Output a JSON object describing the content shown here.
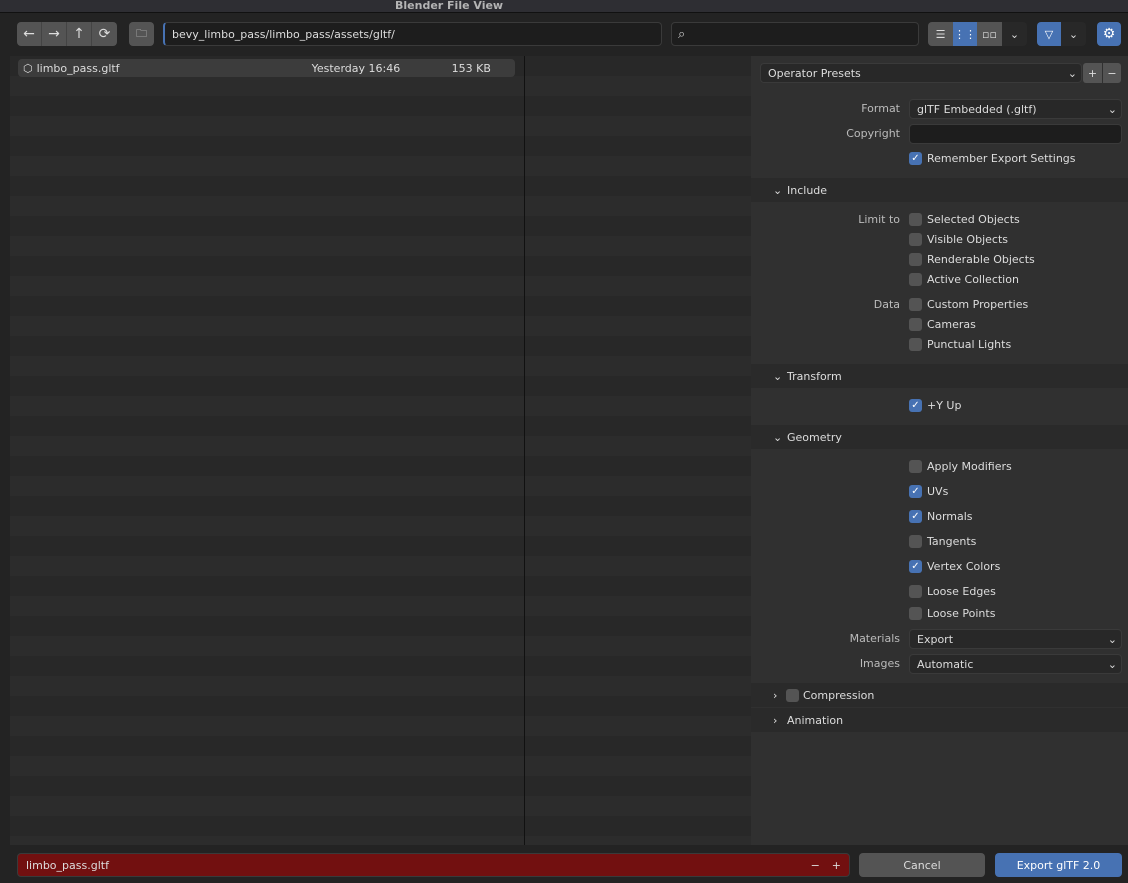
{
  "window": {
    "title": "Blender File View"
  },
  "toolbar": {
    "path": "bevy_limbo_pass/limbo_pass/assets/gltf/",
    "search_placeholder": "",
    "back": "←",
    "forward": "→",
    "parent": "↑",
    "refresh": "⟳",
    "view_modes": [
      "vertical-list",
      "horizontal-list",
      "thumbnails"
    ],
    "active_view": "horizontal-list",
    "accent": "#4772b3"
  },
  "files": [
    {
      "name": "limbo_pass.gltf",
      "date": "Yesterday 16:46",
      "size": "153 KB",
      "icon": "mesh-cube-icon"
    }
  ],
  "panel": {
    "presets": "Operator Presets",
    "format_label": "Format",
    "format_value": "glTF Embedded (.gltf)",
    "copyright_label": "Copyright",
    "copyright_value": "",
    "remember": {
      "label": "Remember Export Settings",
      "checked": true
    },
    "include": {
      "title": "Include",
      "limit_label": "Limit to",
      "limit": [
        {
          "label": "Selected Objects",
          "checked": false
        },
        {
          "label": "Visible Objects",
          "checked": false
        },
        {
          "label": "Renderable Objects",
          "checked": false
        },
        {
          "label": "Active Collection",
          "checked": false
        }
      ],
      "data_label": "Data",
      "data": [
        {
          "label": "Custom Properties",
          "checked": false
        },
        {
          "label": "Cameras",
          "checked": false
        },
        {
          "label": "Punctual Lights",
          "checked": false
        }
      ]
    },
    "transform": {
      "title": "Transform",
      "yup": {
        "label": "+Y Up",
        "checked": true
      }
    },
    "geometry": {
      "title": "Geometry",
      "items": [
        {
          "label": "Apply Modifiers",
          "checked": false
        },
        {
          "label": "UVs",
          "checked": true
        },
        {
          "label": "Normals",
          "checked": true
        },
        {
          "label": "Tangents",
          "checked": false
        },
        {
          "label": "Vertex Colors",
          "checked": true
        },
        {
          "label": "Loose Edges",
          "checked": false
        },
        {
          "label": "Loose Points",
          "checked": false
        }
      ],
      "materials_label": "Materials",
      "materials_value": "Export",
      "images_label": "Images",
      "images_value": "Automatic"
    },
    "compression": {
      "title": "Compression",
      "checked": false
    },
    "animation": {
      "title": "Animation"
    }
  },
  "footer": {
    "filename": "limbo_pass.gltf",
    "minus": "−",
    "plus": "+",
    "cancel": "Cancel",
    "export": "Export glTF 2.0",
    "filename_bg": "#721010"
  }
}
